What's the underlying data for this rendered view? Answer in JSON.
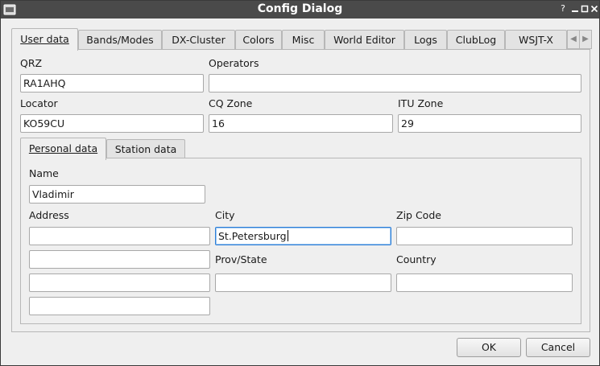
{
  "window": {
    "title": "Config Dialog"
  },
  "tabs": [
    {
      "label": "User data"
    },
    {
      "label": "Bands/Modes"
    },
    {
      "label": "DX-Cluster"
    },
    {
      "label": "Colors"
    },
    {
      "label": "Misc"
    },
    {
      "label": "World Editor"
    },
    {
      "label": "Logs"
    },
    {
      "label": "ClubLog"
    },
    {
      "label": "WSJT-X"
    }
  ],
  "user_data": {
    "qrz_label": "QRZ",
    "qrz_value": "RA1AHQ",
    "operators_label": "Operators",
    "operators_value": "",
    "locator_label": "Locator",
    "locator_value": "KO59CU",
    "cq_zone_label": "CQ Zone",
    "cq_zone_value": "16",
    "itu_zone_label": "ITU Zone",
    "itu_zone_value": "29"
  },
  "subtabs": [
    {
      "label": "Personal data"
    },
    {
      "label": "Station data"
    }
  ],
  "personal": {
    "name_label": "Name",
    "name_value": "Vladimir",
    "address_label": "Address",
    "address_lines": [
      "",
      "",
      "",
      ""
    ],
    "city_label": "City",
    "city_value": "St.Petersburg",
    "zip_label": "Zip Code",
    "zip_value": "",
    "prov_label": "Prov/State",
    "prov_value": "",
    "country_label": "Country",
    "country_value": ""
  },
  "buttons": {
    "ok": "OK",
    "cancel": "Cancel"
  },
  "icons": {
    "app": "app-icon",
    "help": "help-icon",
    "minimize": "minimize-icon",
    "maximize": "maximize-icon",
    "close": "close-icon"
  }
}
